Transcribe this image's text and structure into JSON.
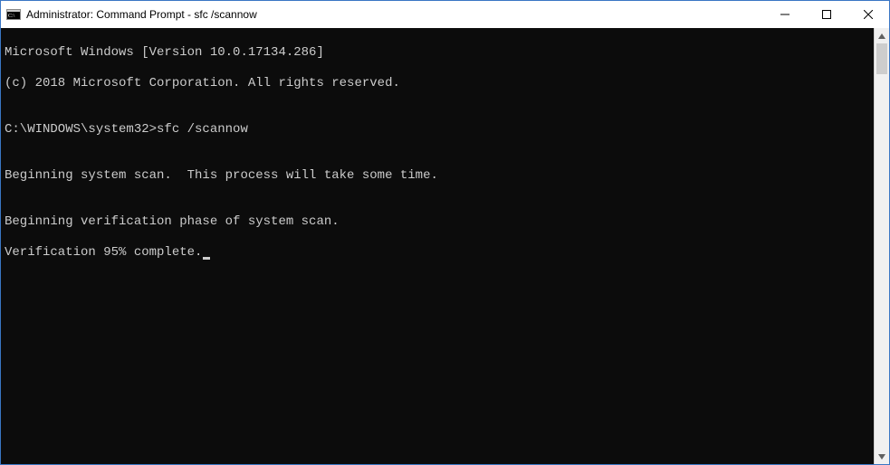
{
  "titlebar": {
    "title": "Administrator: Command Prompt - sfc  /scannow"
  },
  "console": {
    "line1": "Microsoft Windows [Version 10.0.17134.286]",
    "line2": "(c) 2018 Microsoft Corporation. All rights reserved.",
    "blank1": "",
    "prompt_line": "C:\\WINDOWS\\system32>sfc /scannow",
    "blank2": "",
    "line3": "Beginning system scan.  This process will take some time.",
    "blank3": "",
    "line4": "Beginning verification phase of system scan.",
    "line5": "Verification 95% complete."
  }
}
